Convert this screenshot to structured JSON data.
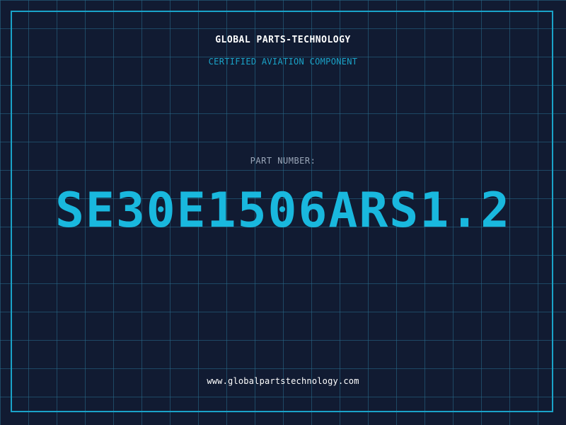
{
  "header": {
    "company": "GLOBAL PARTS-TECHNOLOGY",
    "subtitle": "CERTIFIED AVIATION COMPONENT"
  },
  "part": {
    "label": "PART NUMBER:",
    "number": "SE30E1506ARS1.2"
  },
  "footer": {
    "url": "www.globalpartstechnology.com"
  },
  "colors": {
    "background": "#111b32",
    "accent": "#1aa3c8",
    "part_number": "#19b8de",
    "label": "#9aa6b8",
    "text": "#ffffff"
  }
}
